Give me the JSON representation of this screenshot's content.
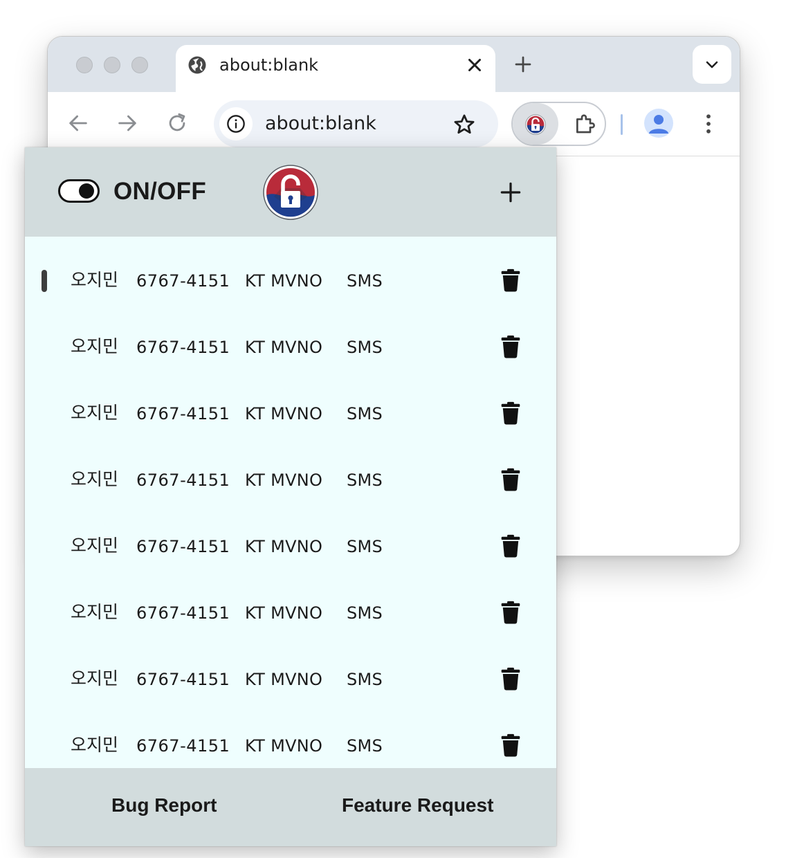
{
  "browser": {
    "tab": {
      "title": "about:blank",
      "icon": "globe-icon"
    },
    "omnibox": {
      "url": "about:blank"
    },
    "colors": {
      "tabstrip": "#dde3ea",
      "omnibox": "#eef2f8"
    }
  },
  "popup": {
    "header": {
      "toggle_label": "ON/OFF",
      "toggle_on": true
    },
    "rows": [
      {
        "name": "오지민",
        "phone": "6767-4151",
        "carrier": "KT MVNO",
        "type": "SMS"
      },
      {
        "name": "오지민",
        "phone": "6767-4151",
        "carrier": "KT MVNO",
        "type": "SMS"
      },
      {
        "name": "오지민",
        "phone": "6767-4151",
        "carrier": "KT MVNO",
        "type": "SMS"
      },
      {
        "name": "오지민",
        "phone": "6767-4151",
        "carrier": "KT MVNO",
        "type": "SMS"
      },
      {
        "name": "오지민",
        "phone": "6767-4151",
        "carrier": "KT MVNO",
        "type": "SMS"
      },
      {
        "name": "오지민",
        "phone": "6767-4151",
        "carrier": "KT MVNO",
        "type": "SMS"
      },
      {
        "name": "오지민",
        "phone": "6767-4151",
        "carrier": "KT MVNO",
        "type": "SMS"
      },
      {
        "name": "오지민",
        "phone": "6767-4151",
        "carrier": "KT MVNO",
        "type": "SMS"
      }
    ],
    "footer": {
      "bug_report": "Bug Report",
      "feature_request": "Feature Request"
    },
    "colors": {
      "header": "#d2dcdd",
      "list_bg": "#effefe",
      "logo_red": "#b92b3a",
      "logo_blue": "#1f3f8f"
    }
  }
}
